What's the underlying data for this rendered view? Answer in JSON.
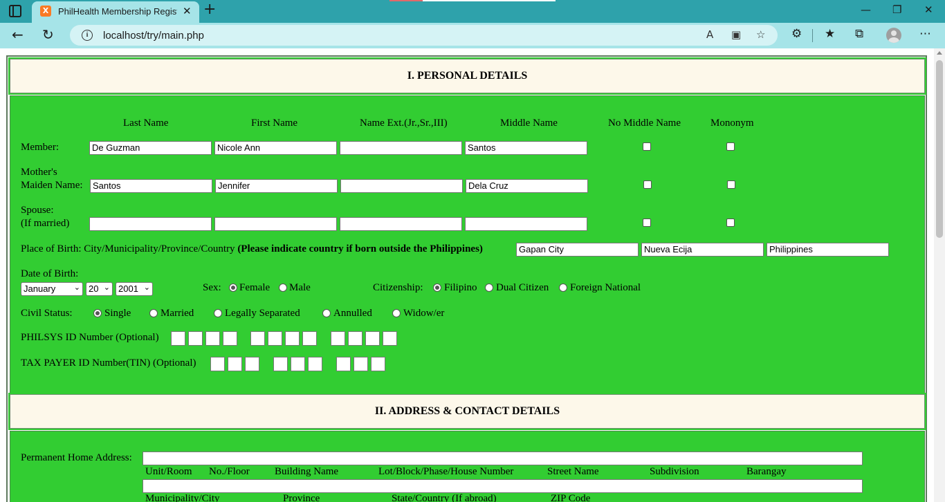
{
  "browser": {
    "tab_title": "PhilHealth Membership Registrati",
    "favicon_text": "X",
    "url": "localhost/try/main.php"
  },
  "section1": {
    "title": "I. PERSONAL DETAILS",
    "col_headers": [
      "Last Name",
      "First Name",
      "Name Ext.(Jr.,Sr.,III)",
      "Middle Name",
      "No Middle Name",
      "Mononym"
    ],
    "member": {
      "label": "Member:",
      "last": "De Guzman",
      "first": "Nicole Ann",
      "ext": "",
      "middle": "Santos"
    },
    "mother": {
      "label_line1": "Mother's",
      "label_line2": "Maiden Name:",
      "last": "Santos",
      "first": "Jennifer",
      "ext": "",
      "middle": "Dela Cruz"
    },
    "spouse": {
      "label_line1": "Spouse:",
      "label_line2": "(If married)",
      "last": "",
      "first": "",
      "ext": "",
      "middle": ""
    },
    "birthplace": {
      "label": "Place of Birth: City/Municipality/Province/Country",
      "note": "(Please indicate country if born outside the Philippines)",
      "city": "Gapan City",
      "province": "Nueva Ecija",
      "country": "Philippines"
    },
    "dob": {
      "label": "Date of Birth:",
      "month": "January",
      "day": "20",
      "year": "2001"
    },
    "sex": {
      "label": "Sex:",
      "options": [
        "Female",
        "Male"
      ],
      "selected": "Female"
    },
    "citizenship": {
      "label": "Citizenship:",
      "options": [
        "Filipino",
        "Dual Citizen",
        "Foreign National"
      ],
      "selected": "Filipino"
    },
    "civil_status": {
      "label": "Civil Status:",
      "options": [
        "Single",
        "Married",
        "Legally Separated",
        "Annulled",
        "Widow/er"
      ],
      "selected": "Single"
    },
    "philsys_label": "PHILSYS ID Number (Optional)",
    "tin_label": "TAX PAYER ID Number(TIN) (Optional)"
  },
  "section2": {
    "title": "II. ADDRESS & CONTACT DETAILS",
    "permanent_label": "Permanent Home Address:",
    "address_line1_captions": [
      "Unit/Room",
      "No./Floor",
      "Building Name",
      "Lot/Block/Phase/House Number",
      "Street Name",
      "Subdivision",
      "Barangay"
    ],
    "address_line2_captions": [
      "Municipality/City",
      "Province",
      "State/Country (If abroad)",
      "ZIP Code"
    ]
  },
  "colors": {
    "form_green": "#32cd32",
    "header_bg": "#fdf8ea",
    "browser_teal": "#2ea2ab"
  }
}
